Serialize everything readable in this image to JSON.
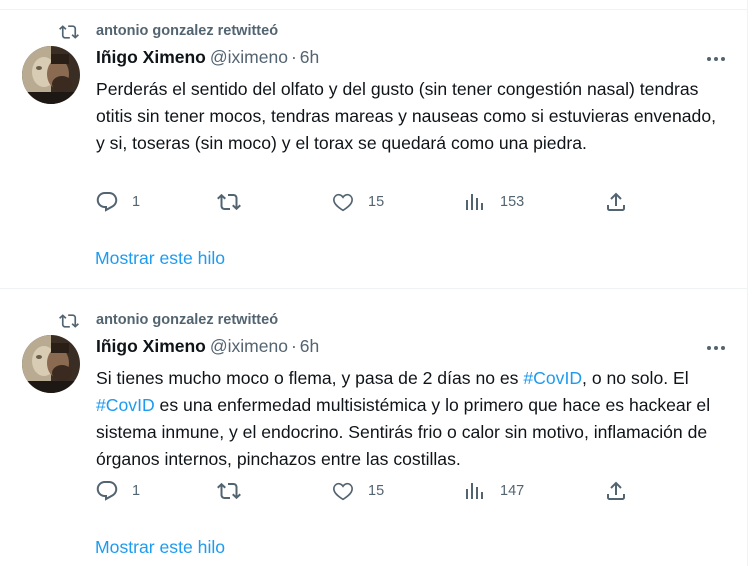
{
  "tweets": [
    {
      "retweeter": "antonio gonzalez retwitteó",
      "author_name": "Iñigo Ximeno",
      "handle": "@iximeno",
      "separator": "·",
      "time": "6h",
      "text_segments": [
        {
          "t": "Perderás el sentido del olfato y del gusto (sin tener congestión nasal) tendras otitis sin tener mocos, tendras mareas y nauseas como si estuvieras envenado, y si, toseras (sin moco) y el torax se quedará como una piedra.",
          "hashtag": false
        }
      ],
      "replies": "1",
      "retweets": "",
      "likes": "15",
      "views": "153",
      "thread_link": "Mostrar este hilo"
    },
    {
      "retweeter": "antonio gonzalez retwitteó",
      "author_name": "Iñigo Ximeno",
      "handle": "@iximeno",
      "separator": "·",
      "time": "6h",
      "text_segments": [
        {
          "t": "Si tienes mucho moco o flema, y pasa de 2 días no es ",
          "hashtag": false
        },
        {
          "t": "#CovID",
          "hashtag": true
        },
        {
          "t": ", o no solo. El ",
          "hashtag": false
        },
        {
          "t": "#CovID",
          "hashtag": true
        },
        {
          "t": " es una enfermedad multisistémica y lo primero que hace es hackear el sistema inmune, y el endocrino. Sentirás frio o calor sin motivo, inflamación de órganos internos, pinchazos entre las costillas.",
          "hashtag": false
        }
      ],
      "replies": "1",
      "retweets": "",
      "likes": "15",
      "views": "147",
      "thread_link": "Mostrar este hilo"
    }
  ],
  "icons": {
    "retweet_context": "retweet-icon",
    "more": "more-dots-icon",
    "reply": "reply-bubble-icon",
    "retweet": "retweet-icon",
    "like": "heart-icon",
    "views": "analytics-bars-icon",
    "share": "share-upload-icon"
  },
  "colors": {
    "text": "#0f1419",
    "secondary": "#536471",
    "link": "#1d9bf0",
    "divider": "#eff3f4"
  }
}
